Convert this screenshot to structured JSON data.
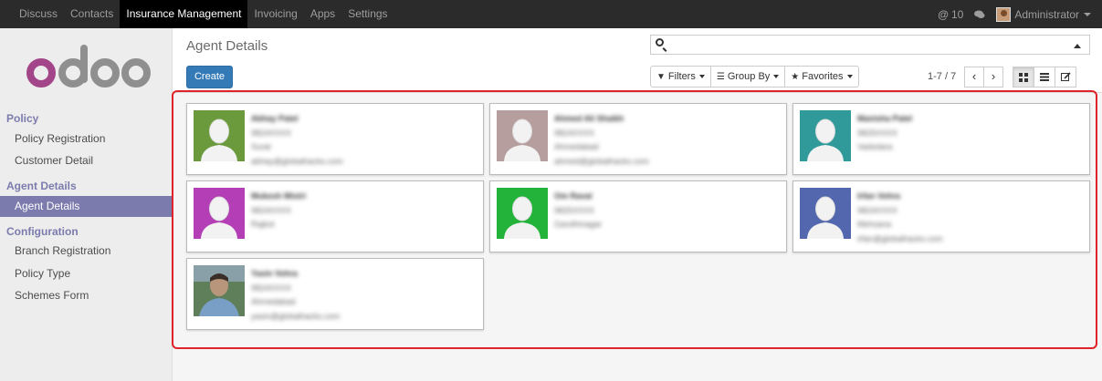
{
  "topbar": {
    "menu": [
      "Discuss",
      "Contacts",
      "Insurance Management",
      "Invoicing",
      "Apps",
      "Settings"
    ],
    "active_menu": "Insurance Management",
    "notifications": "10",
    "user": "Administrator"
  },
  "sidebar": {
    "logo_text": "odoo",
    "sections": [
      {
        "title": "Policy",
        "items": [
          "Policy Registration",
          "Customer Detail"
        ]
      },
      {
        "title": "Agent Details",
        "items": [
          "Agent Details"
        ]
      },
      {
        "title": "Configuration",
        "items": [
          "Branch Registration",
          "Policy Type",
          "Schemes Form"
        ]
      }
    ],
    "active_item": "Agent Details"
  },
  "control_panel": {
    "title": "Agent Details",
    "create_label": "Create",
    "search_placeholder": "",
    "filters_label": "Filters",
    "groupby_label": "Group By",
    "favorites_label": "Favorites",
    "pager": "1-7 / 7"
  },
  "colors": {
    "accent": "#7c7bad",
    "primary_button": "#337ab7",
    "highlight_border": "#e0222a"
  },
  "agents": [
    {
      "name": "Abhay Patel",
      "lines": [
        "9824XXXX",
        "Surat",
        "abhay@globalhacks.com"
      ],
      "avatar_color": "#6a9a3b",
      "avatar": "placeholder"
    },
    {
      "name": "Ahmed Ali Shaikh",
      "lines": [
        "9824XXXX",
        "Ahmedabad",
        "ahmed@globalhacks.com"
      ],
      "avatar_color": "#b79e9e",
      "avatar": "placeholder"
    },
    {
      "name": "Manisha Patel",
      "lines": [
        "9825XXXX",
        "Vadodara"
      ],
      "avatar_color": "#2f9a99",
      "avatar": "placeholder"
    },
    {
      "name": "Mukesh Mistri",
      "lines": [
        "9824XXXX",
        "Rajkot"
      ],
      "avatar_color": "#b43eb6",
      "avatar": "placeholder"
    },
    {
      "name": "Om Raval",
      "lines": [
        "9825XXXX",
        "Gandhinagar"
      ],
      "avatar_color": "#23b33a",
      "avatar": "placeholder"
    },
    {
      "name": "Irfan Vohra",
      "lines": [
        "9824XXXX",
        "Mehsana",
        "irfan@globalhacks.com"
      ],
      "avatar_color": "#5267ae",
      "avatar": "placeholder"
    },
    {
      "name": "Yasin Vohra",
      "lines": [
        "9824XXXX",
        "Ahmedabad",
        "yasin@globalhacks.com"
      ],
      "avatar_color": "#7a9fc7",
      "avatar": "photo"
    }
  ]
}
